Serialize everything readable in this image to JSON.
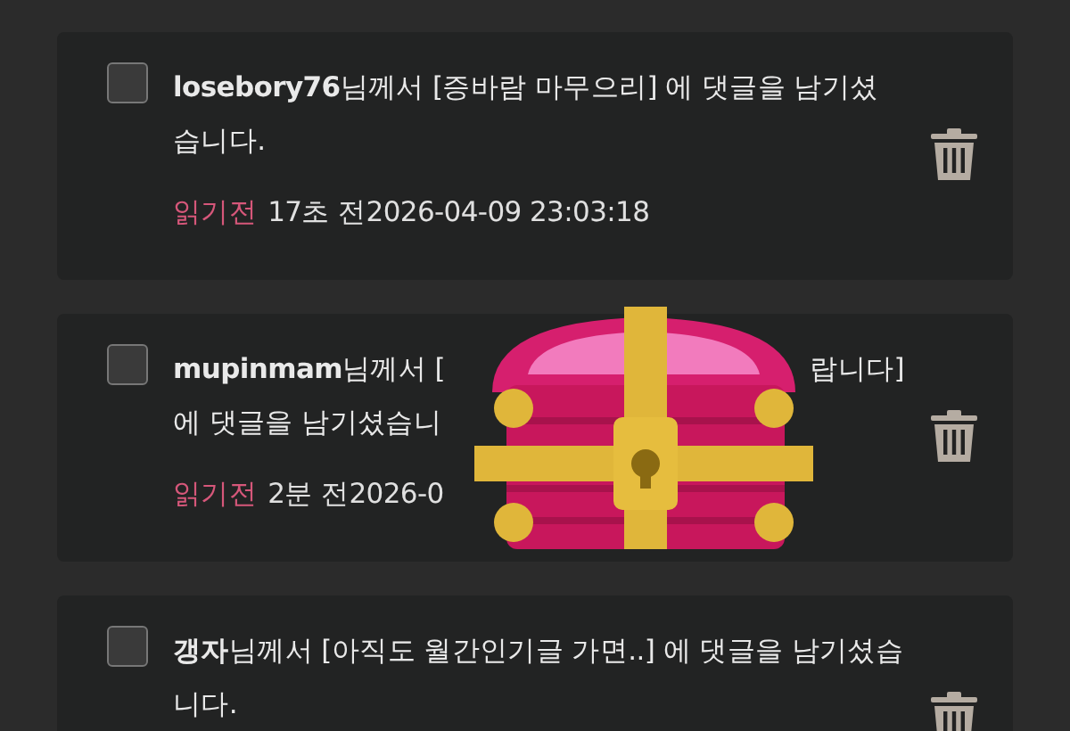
{
  "notifications": [
    {
      "kind": "full",
      "checked": false,
      "user": "losebory76",
      "message": "님께서 [증바람 마무으리] 에 댓글을 남기셨습니다.",
      "status": "읽기전",
      "time": "17초 전2026-04-09 23:03:18"
    },
    {
      "kind": "partly_covered",
      "checked": false,
      "user": "mupinmam",
      "line_1_start": "님께서 [",
      "line_1_end": "랍니다]",
      "line_2": "에 댓글을 남기셨습니",
      "status": "읽기전",
      "time": "2분 전2026-0"
    },
    {
      "kind": "full",
      "checked": false,
      "user": "갱자",
      "message": "님께서 [아직도 월간인기글 가면..] 에 댓글을 남기셨습니다."
    }
  ]
}
